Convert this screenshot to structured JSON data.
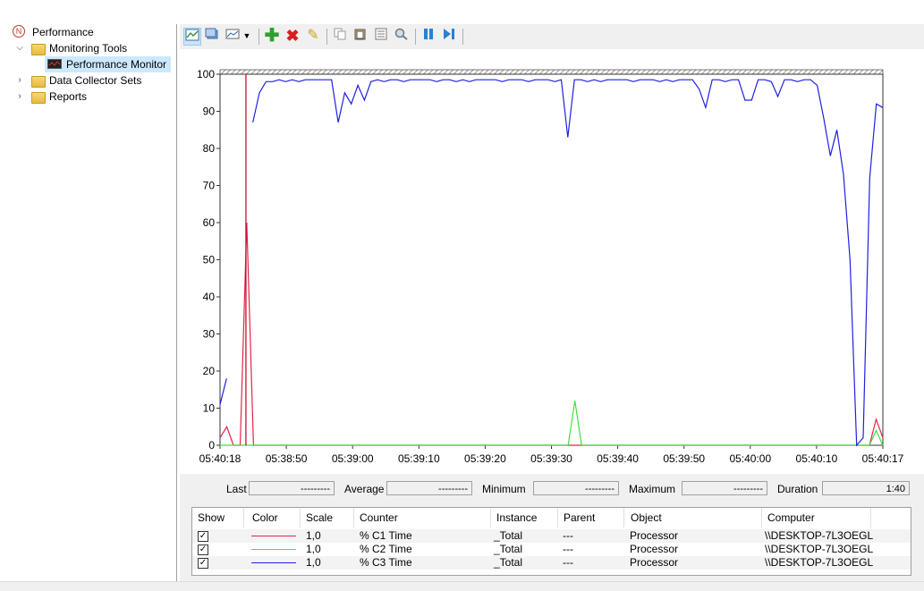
{
  "tree": {
    "root": "Performance",
    "monitoring_tools": "Monitoring Tools",
    "performance_monitor": "Performance Monitor",
    "data_collector_sets": "Data Collector Sets",
    "reports": "Reports"
  },
  "toolbar": {
    "icons": [
      "view-graph-icon",
      "view-current-activity-icon",
      "change-graph-type-icon",
      "add-counter-icon",
      "delete-counter-icon",
      "highlight-icon",
      "copy-properties-icon",
      "paste-counter-list-icon",
      "properties-icon",
      "zoom-icon",
      "freeze-display-icon",
      "update-data-icon"
    ]
  },
  "graph": {
    "y_ticks": [
      "100",
      "90",
      "80",
      "70",
      "60",
      "50",
      "40",
      "30",
      "20",
      "10",
      "0"
    ],
    "x_ticks": [
      "05:40:18",
      "05:38:50",
      "05:39:00",
      "05:39:10",
      "05:39:20",
      "05:39:30",
      "05:39:40",
      "05:39:50",
      "05:40:00",
      "05:40:10",
      "05:40:17"
    ]
  },
  "stats": {
    "last_label": "Last",
    "last_value": "---------",
    "average_label": "Average",
    "average_value": "---------",
    "minimum_label": "Minimum",
    "minimum_value": "---------",
    "maximum_label": "Maximum",
    "maximum_value": "---------",
    "duration_label": "Duration",
    "duration_value": "1:40"
  },
  "legend": {
    "headers": [
      "Show",
      "Color",
      "Scale",
      "Counter",
      "Instance",
      "Parent",
      "Object",
      "Computer"
    ],
    "rows": [
      {
        "show": "✓",
        "color": "#e0264c",
        "scale": "1,0",
        "counter": "% C1 Time",
        "instance": "_Total",
        "parent": "---",
        "object": "Processor",
        "computer": "\\\\DESKTOP-7L3OEGL"
      },
      {
        "show": "✓",
        "color": "#40e040",
        "scale": "1,0",
        "counter": "% C2 Time",
        "instance": "_Total",
        "parent": "---",
        "object": "Processor",
        "computer": "\\\\DESKTOP-7L3OEGL"
      },
      {
        "show": "✓",
        "color": "#2020e0",
        "scale": "1,0",
        "counter": "% C3 Time",
        "instance": "_Total",
        "parent": "---",
        "object": "Processor",
        "computer": "\\\\DESKTOP-7L3OEGL"
      }
    ]
  },
  "chart_data": {
    "type": "line",
    "ylim": [
      0,
      100
    ],
    "x_ticks": [
      "05:40:18",
      "05:38:50",
      "05:39:00",
      "05:39:10",
      "05:39:20",
      "05:39:30",
      "05:39:40",
      "05:39:50",
      "05:40:00",
      "05:40:10",
      "05:40:17"
    ],
    "y_ticks": [
      0,
      10,
      20,
      30,
      40,
      50,
      60,
      70,
      80,
      90,
      100
    ],
    "current_time_index": 4,
    "series": [
      {
        "name": "% C1 Time",
        "color": "#e0264c",
        "values": [
          2,
          5,
          0,
          0,
          60,
          0,
          0,
          0,
          0,
          0,
          0,
          0,
          0,
          0,
          0,
          0,
          0,
          0,
          0,
          0,
          0,
          0,
          0,
          0,
          0,
          0,
          0,
          0,
          0,
          0,
          0,
          0,
          0,
          0,
          0,
          0,
          0,
          0,
          0,
          0,
          0,
          0,
          0,
          0,
          0,
          0,
          0,
          0,
          0,
          0,
          0,
          0,
          0,
          0,
          0,
          0,
          0,
          0,
          0,
          0,
          0,
          0,
          0,
          0,
          0,
          0,
          0,
          0,
          0,
          0,
          0,
          0,
          0,
          0,
          0,
          0,
          0,
          0,
          0,
          0,
          0,
          0,
          0,
          0,
          0,
          0,
          0,
          0,
          0,
          0,
          0,
          0,
          0,
          0,
          0,
          0,
          0,
          0,
          7,
          2
        ]
      },
      {
        "name": "% C2 Time",
        "color": "#40e040",
        "values": [
          0,
          0,
          0,
          0,
          0,
          0,
          0,
          0,
          0,
          0,
          0,
          0,
          0,
          0,
          0,
          0,
          0,
          0,
          0,
          0,
          0,
          0,
          0,
          0,
          0,
          0,
          0,
          0,
          0,
          0,
          0,
          0,
          0,
          0,
          0,
          0,
          0,
          0,
          0,
          0,
          0,
          0,
          0,
          0,
          0,
          0,
          0,
          0,
          0,
          0,
          0,
          0,
          0,
          12,
          0,
          0,
          0,
          0,
          0,
          0,
          0,
          0,
          0,
          0,
          0,
          0,
          0,
          0,
          0,
          0,
          0,
          0,
          0,
          0,
          0,
          0,
          0,
          0,
          0,
          0,
          0,
          0,
          0,
          0,
          0,
          0,
          0,
          0,
          0,
          0,
          0,
          0,
          0,
          0,
          0,
          0,
          0,
          0,
          4,
          0
        ]
      },
      {
        "name": "% C3 Time",
        "color": "#2020e0",
        "values": [
          11,
          18,
          null,
          null,
          null,
          87,
          95,
          98,
          98,
          98.5,
          98,
          98.5,
          98,
          98.5,
          98.5,
          98.5,
          98.5,
          98.5,
          87,
          95,
          92,
          97,
          93,
          98,
          98.5,
          98,
          98.5,
          98.5,
          98,
          98.5,
          98.5,
          98.5,
          98.5,
          98,
          98.5,
          98.5,
          98,
          98.5,
          98,
          98.5,
          98.5,
          98.5,
          98.5,
          98,
          98.5,
          98.5,
          98.5,
          98,
          98.5,
          98.5,
          98.5,
          98,
          98.5,
          83,
          98.5,
          98.5,
          98,
          98.5,
          98,
          98.5,
          98.5,
          98.5,
          98.5,
          98,
          98.5,
          98.5,
          98.5,
          98,
          98.5,
          98,
          98.5,
          98.5,
          98.5,
          96,
          91,
          98.5,
          98.5,
          98,
          98.5,
          98.5,
          93,
          93,
          98.5,
          98.5,
          98,
          94,
          98.5,
          98.5,
          98,
          98.5,
          98.5,
          97,
          88,
          78,
          85,
          73,
          50,
          0,
          2,
          72,
          92,
          91
        ]
      }
    ]
  }
}
